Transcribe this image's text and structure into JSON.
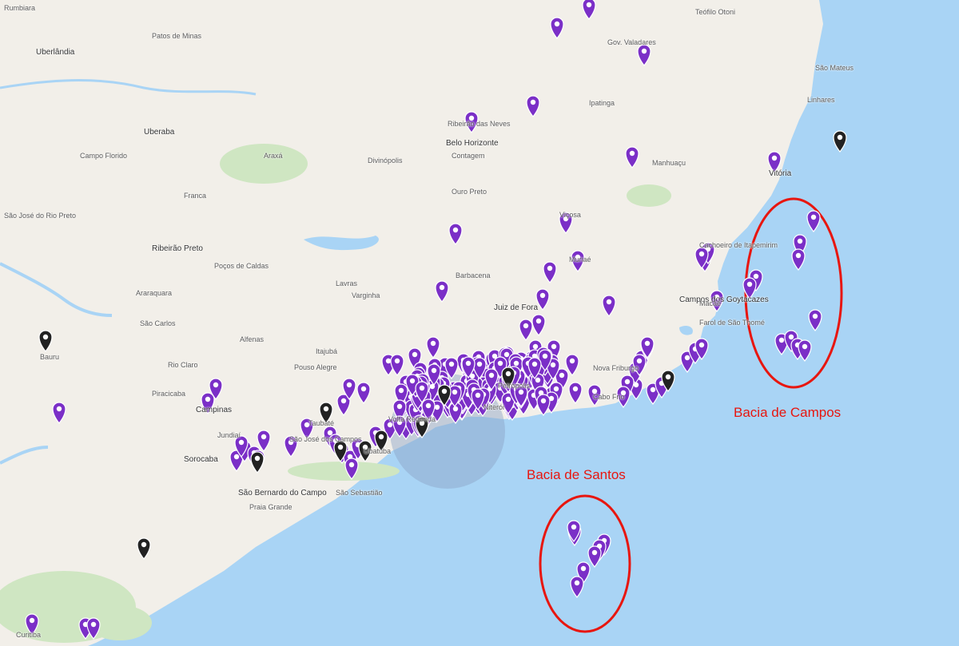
{
  "colors": {
    "land": "#f2efe9",
    "land_green": "#cfe6c2",
    "water": "#a9d4f5",
    "marker_purple": "#7b2fc7",
    "marker_black": "#222222",
    "annotation_red": "#e8160f"
  },
  "icons": {
    "marker_purple": "map-pin-purple-icon",
    "marker_black": "map-pin-black-icon"
  },
  "annotations": [
    {
      "label": "Bacia de Campos"
    },
    {
      "label": "Bacia de Santos"
    }
  ],
  "places": [
    "Rumbiara",
    "Uberlândia",
    "Uberaba",
    "Franca",
    "Ribeirão Preto",
    "São José do Rio Preto",
    "São Carlos",
    "Bauru",
    "Rio Claro",
    "Piracicaba",
    "Campinas",
    "Jundiaí",
    "Sorocaba",
    "São Bernardo do Campo",
    "Praia Grande",
    "Divinópolis",
    "Belo Horizonte",
    "Contagem",
    "Ribeirão das Neves",
    "Ipatinga",
    "Gov. Valadares",
    "Juiz de Fora",
    "Campos dos Goytacazes",
    "Vitória",
    "Cachoeiro de Itapemirim",
    "Farol de São Thomé",
    "Linhares",
    "São Mateus",
    "Teófilo Otoni",
    "Petrópolis",
    "Nova Friburgo",
    "Cabo Frio",
    "Macaé",
    "Niterói",
    "Volta Redonda",
    "São José dos Campos",
    "Taubaté",
    "São Sebastião",
    "Ubatuba",
    "Curitiba",
    "Poços de Caldas",
    "Lavras",
    "Barbacena",
    "Varginha",
    "Alfenas",
    "Itajubá",
    "Pouso Alegre",
    "Araxá",
    "Patos de Minas",
    "Campo Florido",
    "Araraquara",
    "Ouro Preto",
    "Viçosa",
    "Muriaé",
    "Manhuaçu"
  ],
  "markers": {
    "purple_count": 300,
    "black_count": 12
  }
}
